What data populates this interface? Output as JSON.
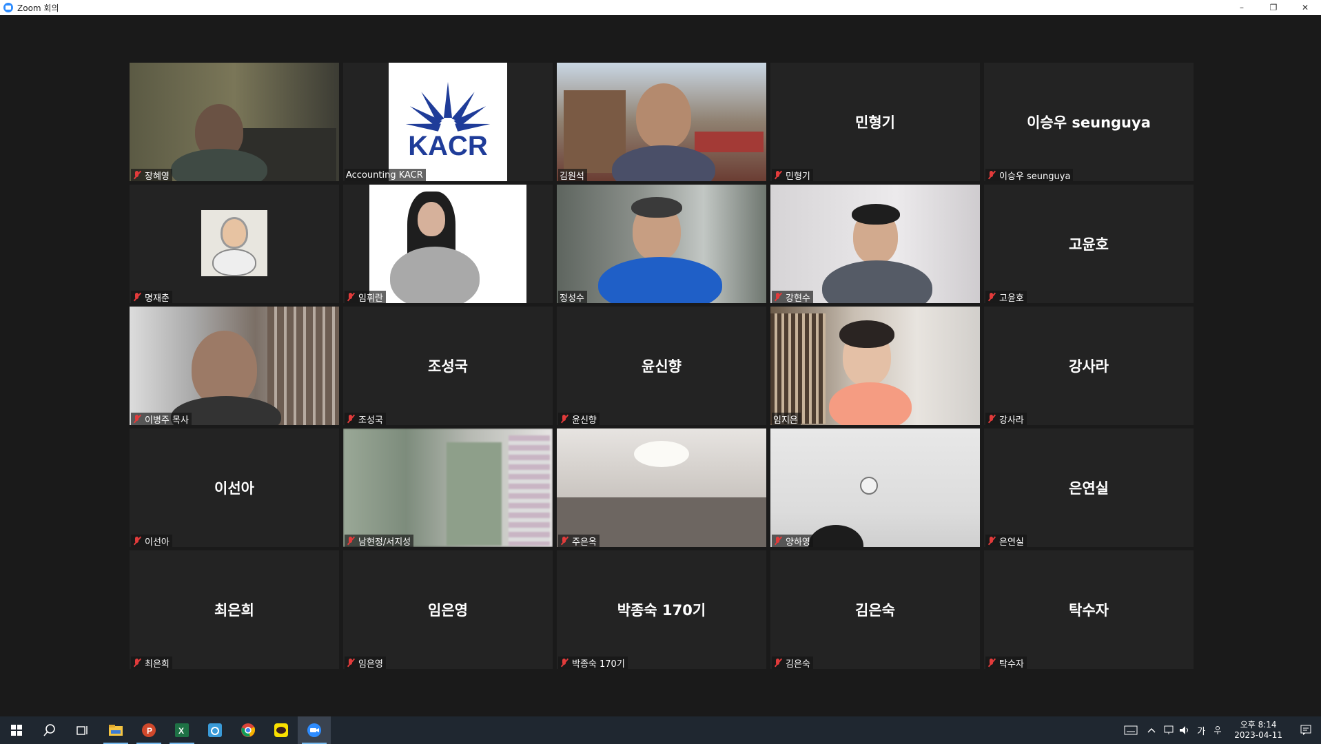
{
  "window": {
    "title": "Zoom 회의",
    "controls": [
      "–",
      "❐",
      "✕"
    ]
  },
  "participants": [
    {
      "name": "장혜영",
      "display": "video"
    },
    {
      "name": "Accounting KACR",
      "display": "logo",
      "logo_text": "KACR"
    },
    {
      "name": "김원석",
      "display": "video",
      "active_speaker": true
    },
    {
      "name": "민형기",
      "display": "name"
    },
    {
      "name": "이승우 seunguya",
      "display": "name"
    },
    {
      "name": "명재춘",
      "display": "avatar"
    },
    {
      "name": "임휘란",
      "display": "video"
    },
    {
      "name": "정성수",
      "display": "video"
    },
    {
      "name": "강현수",
      "display": "video"
    },
    {
      "name": "고윤호",
      "display": "name"
    },
    {
      "name": "이병주 목사",
      "display": "video"
    },
    {
      "name": "조성국",
      "display": "name"
    },
    {
      "name": "윤신향",
      "display": "name"
    },
    {
      "name": "임지은",
      "display": "video"
    },
    {
      "name": "강사라",
      "display": "name"
    },
    {
      "name": "이선아",
      "display": "name"
    },
    {
      "name": "남현정/서지성",
      "display": "video"
    },
    {
      "name": "주은옥",
      "display": "video"
    },
    {
      "name": "양하영",
      "display": "video"
    },
    {
      "name": "은연실",
      "display": "name"
    },
    {
      "name": "최은희",
      "display": "name"
    },
    {
      "name": "임은영",
      "display": "name"
    },
    {
      "name": "박종숙 170기",
      "display": "name"
    },
    {
      "name": "김은숙",
      "display": "name"
    },
    {
      "name": "탁수자",
      "display": "name"
    }
  ],
  "taskbar": {
    "apps": [
      "windows-start-icon",
      "search-icon",
      "task-view-icon",
      "file-explorer-icon",
      "powerpoint-icon",
      "excel-icon",
      "hancom-icon",
      "chrome-icon",
      "kakaotalk-icon",
      "zoom-icon"
    ],
    "ime": "가",
    "time": "오후 8:14",
    "date": "2023-04-11"
  },
  "colors": {
    "active_border": "#e9e27a",
    "tile_bg": "#232323",
    "stage_bg": "#1a1a1a",
    "mic_muted": "#e23b3b"
  }
}
